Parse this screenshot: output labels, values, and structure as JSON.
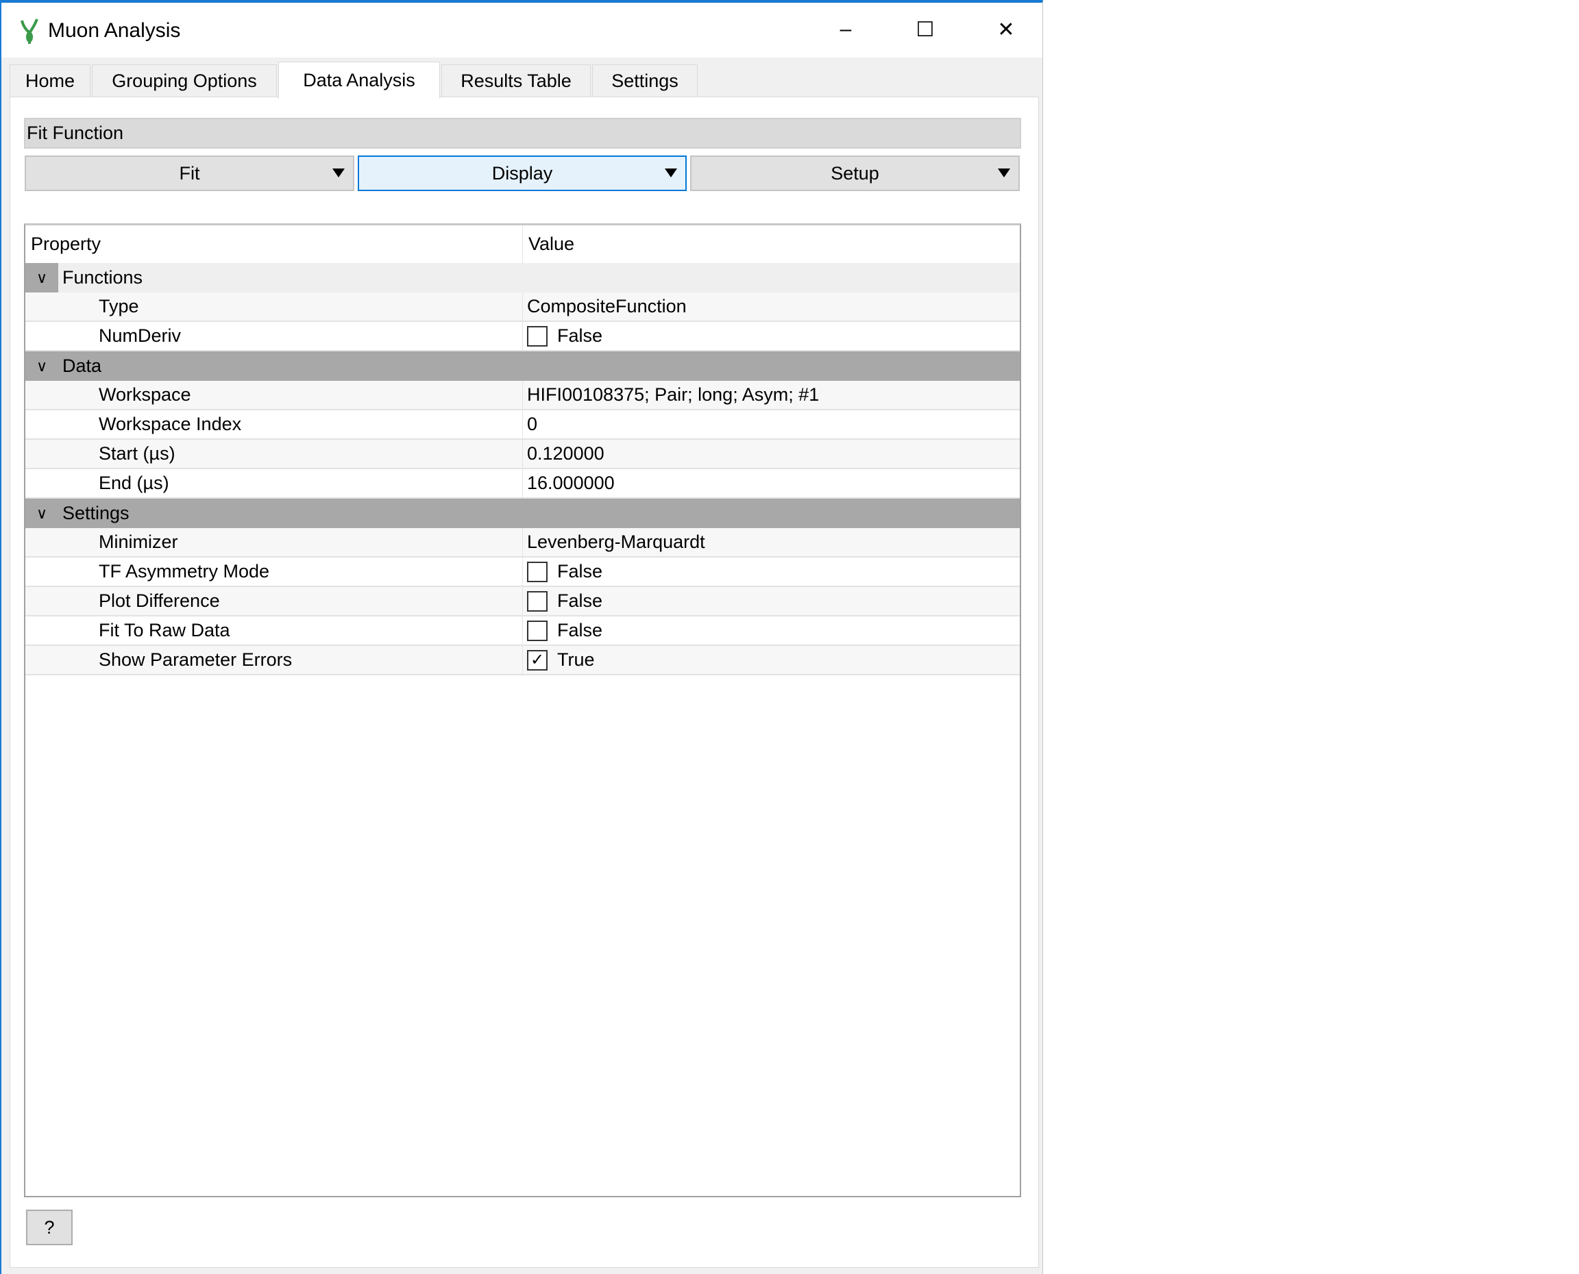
{
  "window": {
    "title": "Muon Analysis",
    "minimize": "–",
    "maximize": "☐",
    "close": "✕"
  },
  "tabs": [
    "Home",
    "Grouping Options",
    "Data Analysis",
    "Results Table",
    "Settings"
  ],
  "fit_function": {
    "label": "Fit Function",
    "buttons": {
      "fit": "Fit",
      "display": "Display",
      "setup": "Setup"
    }
  },
  "table": {
    "headers": {
      "property": "Property",
      "value": "Value"
    },
    "groups": {
      "functions": {
        "label": "Functions",
        "rows": [
          {
            "p": "Type",
            "v": "CompositeFunction"
          },
          {
            "p": "NumDeriv",
            "v": "False",
            "checked": false
          }
        ]
      },
      "data": {
        "label": "Data",
        "rows": [
          {
            "p": "Workspace",
            "v": "HIFI00108375; Pair; long; Asym; #1"
          },
          {
            "p": "Workspace Index",
            "v": "0"
          },
          {
            "p": "Start (µs)",
            "v": "0.120000"
          },
          {
            "p": "End (µs)",
            "v": "16.000000"
          }
        ]
      },
      "settings": {
        "label": "Settings",
        "rows": [
          {
            "p": "Minimizer",
            "v": "Levenberg-Marquardt"
          },
          {
            "p": "TF Asymmetry Mode",
            "v": "False",
            "checked": false
          },
          {
            "p": "Plot Difference",
            "v": "False",
            "checked": false
          },
          {
            "p": "Fit To Raw Data",
            "v": "False",
            "checked": false
          },
          {
            "p": "Show Parameter Errors",
            "v": "True",
            "checked": true
          }
        ]
      }
    }
  },
  "help_button": "?",
  "colors": {
    "accent": "#0078d7",
    "selected_button": "#e5f1fb",
    "group_header": "#a8a8a8"
  }
}
